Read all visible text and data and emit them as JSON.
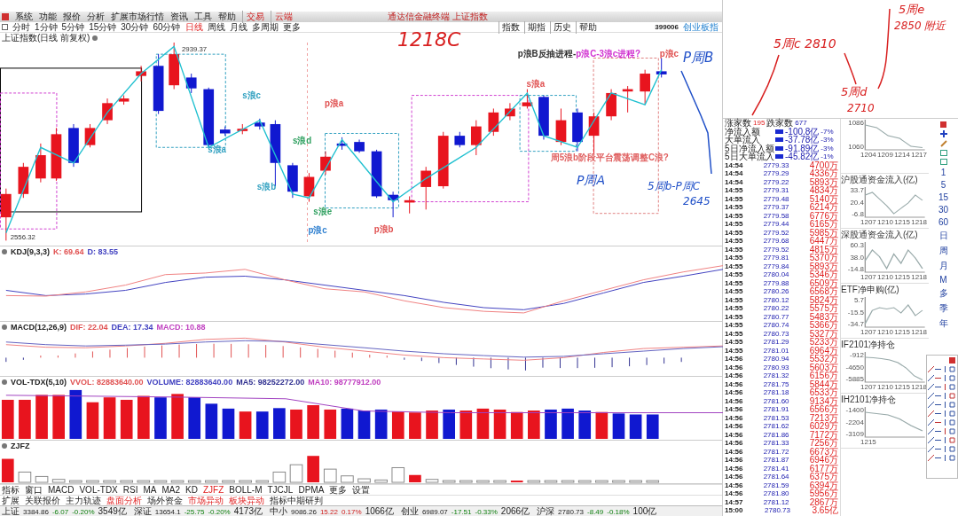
{
  "menu": [
    {
      "label": "系统",
      "kind": "normal"
    },
    {
      "label": "功能",
      "kind": "normal"
    },
    {
      "label": "报价",
      "kind": "normal"
    },
    {
      "label": "分析",
      "kind": "normal"
    },
    {
      "label": "扩展市场行情",
      "kind": "normal"
    },
    {
      "label": "资讯",
      "kind": "normal"
    },
    {
      "label": "工具",
      "kind": "normal"
    },
    {
      "label": "帮助",
      "kind": "normal"
    },
    {
      "label": "交易",
      "kind": "highlight"
    },
    {
      "label": "云端",
      "kind": "highlight"
    }
  ],
  "window_title": "通达信金融终端 上证指数",
  "periods": [
    {
      "label": "分时",
      "selected": false
    },
    {
      "label": "1分钟",
      "selected": false
    },
    {
      "label": "5分钟",
      "selected": false
    },
    {
      "label": "15分钟",
      "selected": false
    },
    {
      "label": "30分钟",
      "selected": false
    },
    {
      "label": "60分钟",
      "selected": false
    },
    {
      "label": "日线",
      "selected": true
    },
    {
      "label": "周线",
      "selected": false
    },
    {
      "label": "月线",
      "selected": false
    },
    {
      "label": "多周期",
      "selected": false
    },
    {
      "label": "更多",
      "selected": false
    }
  ],
  "quick_links": [
    "指数",
    "期指",
    "历史",
    "帮助"
  ],
  "security": {
    "code": "399006",
    "name": "创业板指"
  },
  "chart_title": "上证指数(日线 前复权)",
  "main_chart": {
    "high": "2939.37",
    "low": "2556.32",
    "note": [
      {
        "text": "p浪B反抽进程-",
        "color": "#303030"
      },
      {
        "text": "p浪C-3浪c进程?",
        "color": "#d030d0"
      }
    ],
    "side_note": "周5浪b阶段平台震荡调整C浪?",
    "wave_labels": [
      {
        "text": "s浪c",
        "color": "#30a0c0"
      },
      {
        "text": "s浪a",
        "color": "#30a0c0"
      },
      {
        "text": "s浪b",
        "color": "#30a0c0"
      },
      {
        "text": "s浪d",
        "color": "#30a060"
      },
      {
        "text": "s浪e",
        "color": "#30a060"
      },
      {
        "text": "p浪a",
        "color": "#e05050"
      },
      {
        "text": "p浪c",
        "color": "#3080d0"
      },
      {
        "text": "p浪b",
        "color": "#e05050"
      },
      {
        "text": "s浪a",
        "color": "#e05050"
      },
      {
        "text": "p浪c",
        "color": "#e05050"
      }
    ]
  },
  "indicators": [
    {
      "name": "KDJ(9,3,3)",
      "values": [
        {
          "label": "K: 69.64",
          "color": "#e05050"
        },
        {
          "label": "D: 83.55",
          "color": "#4040c0"
        }
      ]
    },
    {
      "name": "MACD(12,26,9)",
      "values": [
        {
          "label": "DIF: 22.04",
          "color": "#e05050"
        },
        {
          "label": "DEA: 17.34",
          "color": "#4040c0"
        },
        {
          "label": "MACD: 10.88",
          "color": "#c040c0"
        }
      ]
    },
    {
      "name": "VOL-TDX(5,10)",
      "values": [
        {
          "label": "VVOL: 82883640.00",
          "color": "#e05050"
        },
        {
          "label": "VOLUME: 82883640.00",
          "color": "#4040c0"
        },
        {
          "label": "MA5: 98252272.00",
          "color": "#303090"
        },
        {
          "label": "MA10: 98777912.00",
          "color": "#c040c0"
        }
      ]
    },
    {
      "name": "ZJFZ"
    }
  ],
  "indicator_tabs": [
    {
      "label": "指标",
      "selected": false
    },
    {
      "label": "窗口",
      "selected": false
    },
    {
      "label": "MACD",
      "selected": false
    },
    {
      "label": "VOL-TDX",
      "selected": false
    },
    {
      "label": "RSI",
      "selected": false
    },
    {
      "label": "MA",
      "selected": false
    },
    {
      "label": "MA2",
      "selected": false
    },
    {
      "label": "KD",
      "selected": false
    },
    {
      "label": "ZJFZ",
      "selected": true
    },
    {
      "label": "BOLL-M",
      "selected": false
    },
    {
      "label": "TJCJL",
      "selected": false
    },
    {
      "label": "DPMA",
      "selected": false
    },
    {
      "label": "更多",
      "selected": false
    },
    {
      "label": "设置",
      "selected": false
    }
  ],
  "extension_tabs": [
    {
      "label": "扩展",
      "kind": "normal"
    },
    {
      "label": "关联报价",
      "kind": "normal"
    },
    {
      "label": "主力轨迹",
      "kind": "normal"
    },
    {
      "label": "盘面分析",
      "kind": "highlight"
    },
    {
      "label": "场外资金",
      "kind": "normal"
    },
    {
      "label": "市场异动",
      "kind": "highlight"
    },
    {
      "label": "板块异动",
      "kind": "highlight"
    },
    {
      "label": "指标中期研判",
      "kind": "normal"
    }
  ],
  "status_bar": [
    {
      "name": "上证",
      "price": "3384.86",
      "change": "-6.07",
      "pct": "-0.20%",
      "amount": "3549亿"
    },
    {
      "name": "深证",
      "price": "13654.1",
      "change": "-25.75",
      "pct": "-0.20%",
      "amount": "4173亿"
    },
    {
      "name": "中小",
      "price": "9086.26",
      "change": "15.22",
      "pct": "0.17%",
      "amount": "1066亿"
    },
    {
      "name": "创业",
      "price": "6989.07",
      "change": "-17.51",
      "pct": "-0.33%",
      "amount": "2066亿"
    },
    {
      "name": "沪深",
      "price": "2780.73",
      "change": "-8.49",
      "pct": "-0.18%",
      "amount": "100亿"
    }
  ],
  "breadth": [
    {
      "label": "涨家数",
      "value": "195"
    },
    {
      "label": "跌家数",
      "value": "677"
    }
  ],
  "flows": [
    {
      "label": "净流入额",
      "value": "-100.8亿",
      "pct": "-7%"
    },
    {
      "label": "大单流入",
      "value": "-37.78亿",
      "pct": "-3%"
    },
    {
      "label": "5日净流入额",
      "value": "-91.89亿",
      "pct": "-3%"
    },
    {
      "label": "5日大单流入",
      "value": "-45.82亿",
      "pct": "-1%"
    }
  ],
  "ticks": [
    {
      "time": "14:54",
      "price": "2779.33",
      "volume": "4700万"
    },
    {
      "time": "14:54",
      "price": "2779.29",
      "volume": "4336万"
    },
    {
      "time": "14:54",
      "price": "2779.22",
      "volume": "5893万"
    },
    {
      "time": "14:55",
      "price": "2779.31",
      "volume": "4834万"
    },
    {
      "time": "14:55",
      "price": "2779.48",
      "volume": "5140万"
    },
    {
      "time": "14:55",
      "price": "2779.37",
      "volume": "6214万"
    },
    {
      "time": "14:55",
      "price": "2779.58",
      "volume": "6776万"
    },
    {
      "time": "14:55",
      "price": "2779.44",
      "volume": "6165万"
    },
    {
      "time": "14:55",
      "price": "2779.52",
      "volume": "5985万"
    },
    {
      "time": "14:55",
      "price": "2779.68",
      "volume": "6447万"
    },
    {
      "time": "14:55",
      "price": "2779.52",
      "volume": "4815万"
    },
    {
      "time": "14:55",
      "price": "2779.81",
      "volume": "5370万"
    },
    {
      "time": "14:55",
      "price": "2779.84",
      "volume": "5893万"
    },
    {
      "time": "14:55",
      "price": "2780.04",
      "volume": "5346万"
    },
    {
      "time": "14:55",
      "price": "2779.88",
      "volume": "6509万"
    },
    {
      "time": "14:55",
      "price": "2780.26",
      "volume": "6568万"
    },
    {
      "time": "14:55",
      "price": "2780.12",
      "volume": "5824万"
    },
    {
      "time": "14:55",
      "price": "2780.22",
      "volume": "5575万"
    },
    {
      "time": "14:55",
      "price": "2780.77",
      "volume": "5483万"
    },
    {
      "time": "14:55",
      "price": "2780.74",
      "volume": "5366万"
    },
    {
      "time": "14:55",
      "price": "2780.73",
      "volume": "5327万"
    },
    {
      "time": "14:55",
      "price": "2781.29",
      "volume": "5233万"
    },
    {
      "time": "14:55",
      "price": "2781.01",
      "volume": "6964万"
    },
    {
      "time": "14:56",
      "price": "2780.94",
      "volume": "5532万"
    },
    {
      "time": "14:56",
      "price": "2780.93",
      "volume": "5603万"
    },
    {
      "time": "14:56",
      "price": "2781.32",
      "volume": "6156万"
    },
    {
      "time": "14:56",
      "price": "2781.75",
      "volume": "5844万"
    },
    {
      "time": "14:56",
      "price": "2781.18",
      "volume": "6533万"
    },
    {
      "time": "14:56",
      "price": "2781.60",
      "volume": "9134万"
    },
    {
      "time": "14:56",
      "price": "2781.91",
      "volume": "6566万"
    },
    {
      "time": "14:56",
      "price": "2781.53",
      "volume": "7213万"
    },
    {
      "time": "14:56",
      "price": "2781.62",
      "volume": "6029万"
    },
    {
      "time": "14:56",
      "price": "2781.86",
      "volume": "7172万"
    },
    {
      "time": "14:56",
      "price": "2781.33",
      "volume": "7256万"
    },
    {
      "time": "14:56",
      "price": "2781.72",
      "volume": "6673万"
    },
    {
      "time": "14:56",
      "price": "2781.87",
      "volume": "6946万"
    },
    {
      "time": "14:56",
      "price": "2781.41",
      "volume": "6177万"
    },
    {
      "time": "14:56",
      "price": "2781.64",
      "volume": "6375万"
    },
    {
      "time": "14:56",
      "price": "2781.59",
      "volume": "6394万"
    },
    {
      "time": "14:56",
      "price": "2781.80",
      "volume": "5956万"
    },
    {
      "time": "14:57",
      "price": "2781.12",
      "volume": "2867万"
    },
    {
      "time": "15:00",
      "price": "2780.73",
      "volume": "3.65亿"
    }
  ],
  "mini_charts": [
    {
      "yticks": [
        "1086",
        "1060"
      ],
      "xticks": [
        "1204",
        "1209",
        "1214",
        "1217"
      ]
    },
    {
      "title": "沪股通资金流入(亿)",
      "yticks": [
        "33.7",
        "20.4",
        "-6.8"
      ],
      "xticks": [
        "1207",
        "1210",
        "1215",
        "1218"
      ]
    },
    {
      "title": "深股通资金流入(亿)",
      "yticks": [
        "60.3",
        "38.0",
        "-14.8"
      ],
      "xticks": [
        "1207",
        "1210",
        "1215",
        "1218"
      ]
    },
    {
      "title": "ETF净申购(亿)",
      "yticks": [
        "5.7",
        "-15.5",
        "-34.7"
      ],
      "xticks": [
        "1207",
        "1210",
        "1215",
        "1218"
      ]
    },
    {
      "title": "IF2101净持仓",
      "yticks": [
        "-912",
        "-4650",
        "-5885"
      ],
      "xticks": [
        "1207",
        "1210",
        "1215",
        "1218"
      ]
    },
    {
      "title": "IH2101净持仓",
      "yticks": [
        "-1400",
        "-2204",
        "-3109"
      ],
      "xticks": [
        "1215"
      ]
    }
  ],
  "side_periods": [
    "1",
    "5",
    "15",
    "30",
    "60",
    "日",
    "周",
    "月",
    "M",
    "多",
    "季",
    "年"
  ],
  "annotations": [
    {
      "text": "1218C",
      "color": "#d82020"
    },
    {
      "text": "P周B",
      "color": "#2050c8"
    },
    {
      "text": "P周A",
      "color": "#2050c8"
    },
    {
      "text": "5周b-P周C",
      "color": "#2050c8"
    },
    {
      "text": "2645",
      "color": "#2050c8"
    },
    {
      "text": "5周c 2810",
      "color": "#d82020"
    },
    {
      "text": "5周d",
      "color": "#d82020"
    },
    {
      "text": "2710",
      "color": "#d82020"
    },
    {
      "text": "5周e",
      "color": "#d82020"
    },
    {
      "text": "2850 附近",
      "color": "#d82020"
    }
  ]
}
